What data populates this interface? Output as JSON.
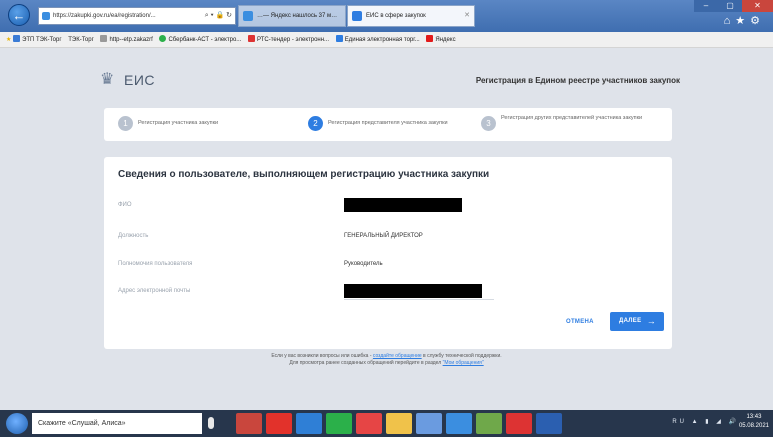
{
  "browser": {
    "address": "https://zakupki.gov.ru/ea/registration/...",
    "tabs": [
      {
        "label": "…— Яндекс нашлось 37 м…",
        "color": "#3b8ee0"
      },
      {
        "label": "ЕИС в сфере закупок",
        "color": "#2e7de1"
      }
    ],
    "favorites": [
      {
        "label": "ЭТП ТЭК-Торг",
        "color": "#3a7bd5"
      },
      {
        "label": "ТЭК-Торг",
        "color": "#3a7bd5"
      },
      {
        "label": "http--etp.zakazrf",
        "color": "#999999"
      },
      {
        "label": "Сбербанк-АСТ - электро...",
        "color": "#2bb04a"
      },
      {
        "label": "РТС-тендер - электронн...",
        "color": "#d33"
      },
      {
        "label": "Единая электронная торг...",
        "color": "#2e7de1"
      },
      {
        "label": "Яндекс",
        "color": "#e21a1a"
      }
    ]
  },
  "header": {
    "logo_text": "ЕИС",
    "title": "Регистрация в Едином реестре участников закупок"
  },
  "steps": [
    {
      "num": "1",
      "label": "Регистрация участника закупки",
      "active": false
    },
    {
      "num": "2",
      "label": "Регистрация представителя участника закупки",
      "active": true
    },
    {
      "num": "3",
      "label": "Регистрация других представителей участника закупки",
      "active": false
    }
  ],
  "card": {
    "title": "Сведения о пользователе, выполняющем регистрацию участника закупки",
    "rows": [
      {
        "key": "ФИО",
        "value": ""
      },
      {
        "key": "Должность",
        "value": "ГЕНЕРАЛЬНЫЙ ДИРЕКТОР"
      },
      {
        "key": "Полномочия пользователя",
        "value": "Руководитель"
      },
      {
        "key": "Адрес электронной почты",
        "value": ""
      }
    ]
  },
  "actions": {
    "cancel": "ОТМЕНА",
    "next": "ДАЛЕЕ"
  },
  "support": {
    "line1_pre": "Если у вас возникли вопросы или ошибка - ",
    "line1_link": "создайте обращение",
    "line1_post": " в службу технической поддержки.",
    "line2_pre": "Для просмотра ранее созданных обращений перейдите в раздел ",
    "line2_link": "\"Мои обращения\""
  },
  "taskbar": {
    "search": "Скажите «Слушай, Алиса»",
    "tray": "RU",
    "time": "13:43",
    "date": "05.08.2021",
    "apps": [
      "#c9463d",
      "#e2322b",
      "#2f7fd6",
      "#2bb04a",
      "#e64545",
      "#f0c24a",
      "#6a9be0",
      "#3b8ee0",
      "#6fa84a",
      "#d33",
      "#2b5fb0"
    ]
  },
  "colors": {
    "accent": "#2e7de1",
    "step_inactive": "#b9c2cf"
  }
}
